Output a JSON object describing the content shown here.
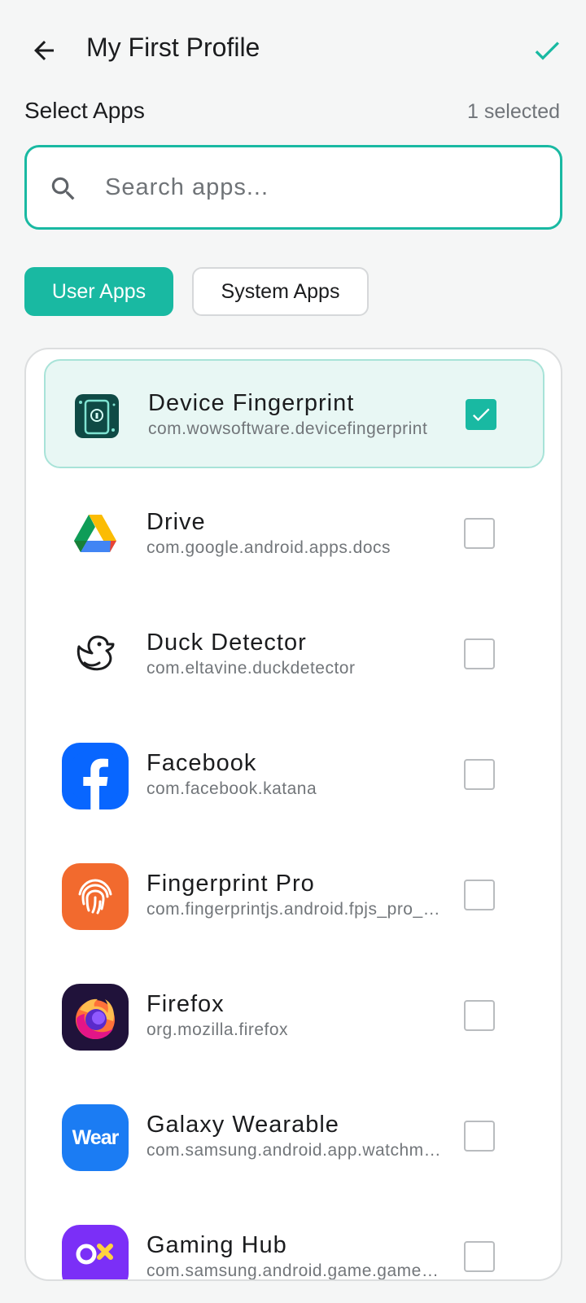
{
  "header": {
    "title": "My First Profile",
    "back_icon": "arrow-left-icon",
    "confirm_icon": "check-icon"
  },
  "section": {
    "title": "Select Apps",
    "selected_count": "1 selected"
  },
  "search": {
    "placeholder": "Search apps...",
    "value": "",
    "icon": "search-icon"
  },
  "tabs": [
    {
      "label": "User Apps",
      "active": true
    },
    {
      "label": "System Apps",
      "active": false
    }
  ],
  "apps": [
    {
      "name": "Device Fingerprint",
      "package": "com.wowsoftware.devicefingerprint",
      "checked": true,
      "icon": "device-fingerprint-icon"
    },
    {
      "name": "Drive",
      "package": "com.google.android.apps.docs",
      "checked": false,
      "icon": "google-drive-icon"
    },
    {
      "name": "Duck Detector",
      "package": "com.eltavine.duckdetector",
      "checked": false,
      "icon": "duck-icon"
    },
    {
      "name": "Facebook",
      "package": "com.facebook.katana",
      "checked": false,
      "icon": "facebook-icon"
    },
    {
      "name": "Fingerprint Pro",
      "package": "com.fingerprintjs.android.fpjs_pro_demo",
      "checked": false,
      "icon": "fingerprint-icon"
    },
    {
      "name": "Firefox",
      "package": "org.mozilla.firefox",
      "checked": false,
      "icon": "firefox-icon"
    },
    {
      "name": "Galaxy Wearable",
      "package": "com.samsung.android.app.watchmanager",
      "checked": false,
      "icon": "wear-icon",
      "icon_text": "Wear"
    },
    {
      "name": "Gaming Hub",
      "package": "com.samsung.android.game.gamehome",
      "checked": false,
      "icon": "gaming-hub-icon"
    }
  ],
  "colors": {
    "accent": "#19b9a2",
    "background": "#f5f6f6",
    "selected_row": "#e8f7f4"
  }
}
